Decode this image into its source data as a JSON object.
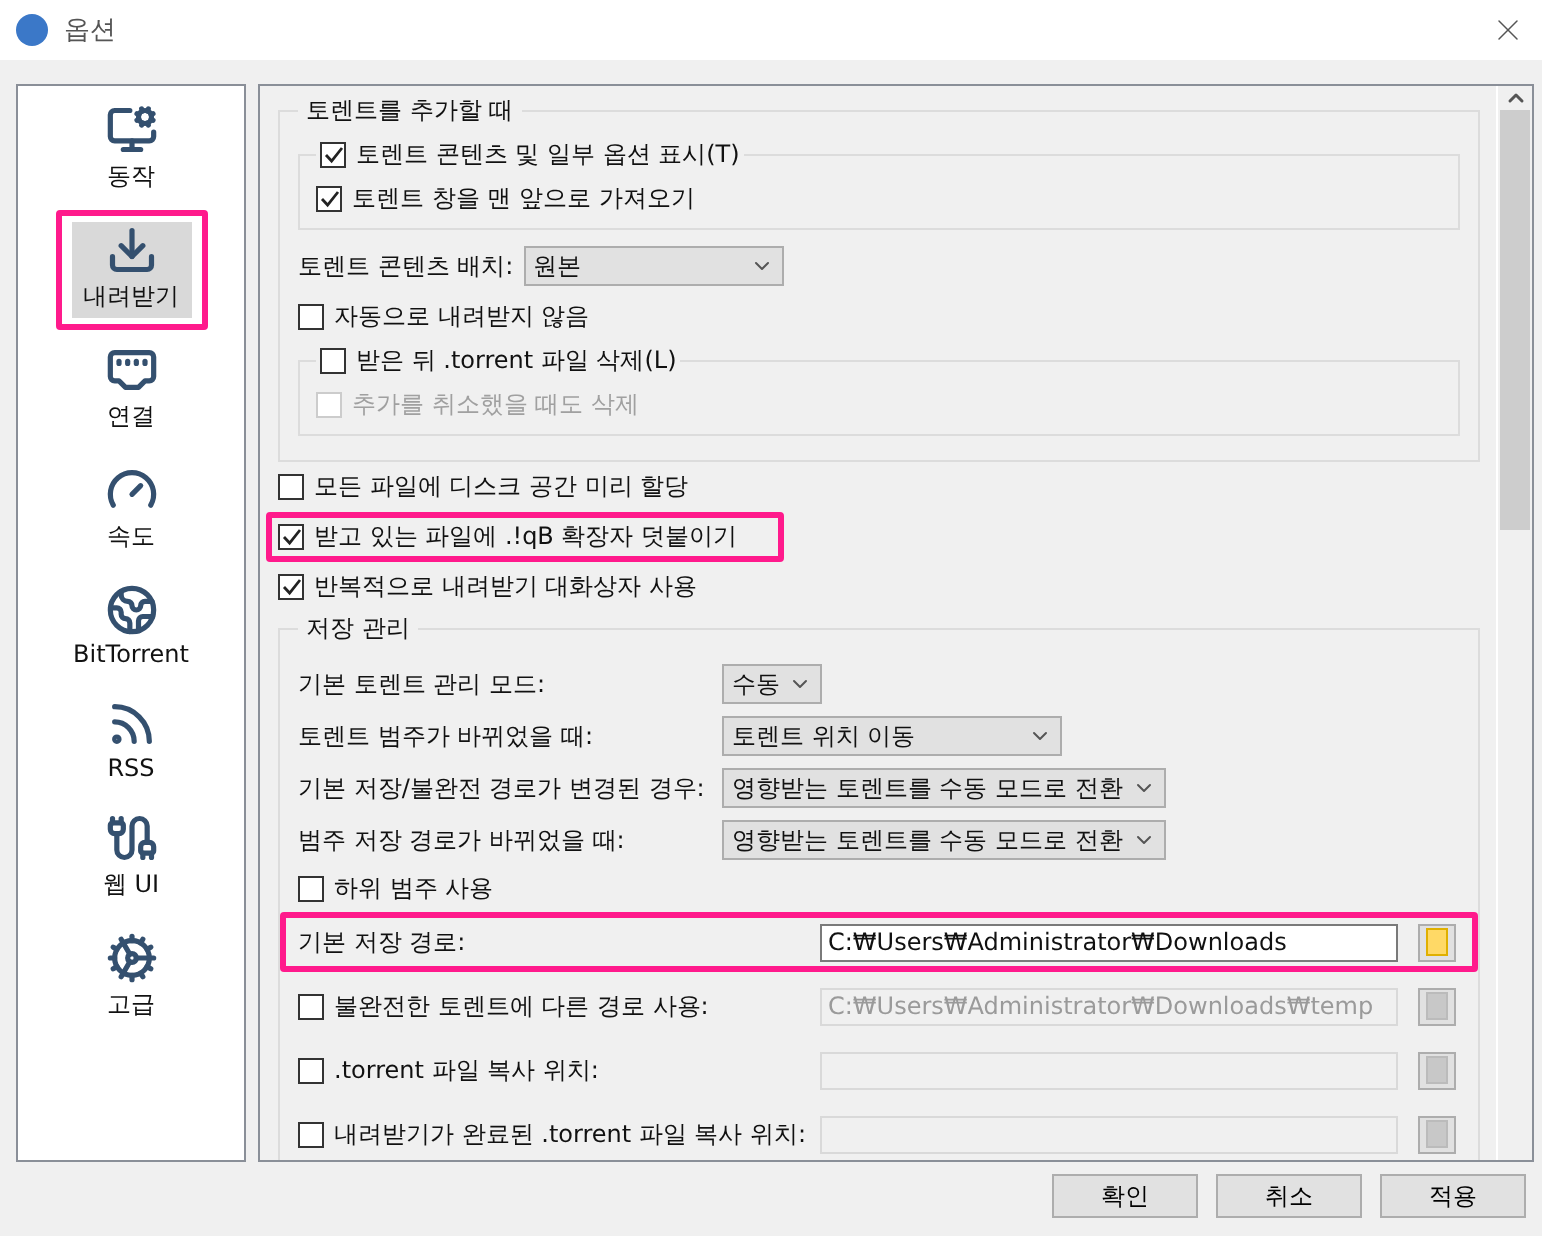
{
  "window": {
    "title": "옵션"
  },
  "sidebar": {
    "items": [
      {
        "label": "동작",
        "selected": false,
        "highlighted": false
      },
      {
        "label": "내려받기",
        "selected": true,
        "highlighted": true
      },
      {
        "label": "연결",
        "selected": false,
        "highlighted": false
      },
      {
        "label": "속도",
        "selected": false,
        "highlighted": false
      },
      {
        "label": "BitTorrent",
        "selected": false,
        "highlighted": false
      },
      {
        "label": "RSS",
        "selected": false,
        "highlighted": false
      },
      {
        "label": "웹 UI",
        "selected": false,
        "highlighted": false
      },
      {
        "label": "고급",
        "selected": false,
        "highlighted": false
      }
    ]
  },
  "adding_group": {
    "title": "토렌트를 추가할 때",
    "dialog_options": [
      {
        "label": "토렌트 콘텐츠 및 일부 옵션 표시(T)",
        "checked": true
      },
      {
        "label": "토렌트 창을 맨 앞으로 가져오기",
        "checked": true
      }
    ],
    "layout": {
      "label": "토렌트 콘텐츠 배치:",
      "value": "원본"
    },
    "no_auto_start": {
      "label": "자동으로 내려받지 않음",
      "checked": false
    },
    "delete_torrent": {
      "label": "받은 뒤 .torrent 파일 삭제(L)",
      "checked": false
    },
    "delete_on_cancel": {
      "label": "추가를 취소했을 때도 삭제",
      "checked": false,
      "disabled": true
    }
  },
  "options": [
    {
      "label": "모든 파일에 디스크 공간 미리 할당",
      "checked": false,
      "highlighted": false
    },
    {
      "label": "받고 있는 파일에 .!qB 확장자 덧붙이기",
      "checked": true,
      "highlighted": true
    },
    {
      "label": "반복적으로 내려받기 대화상자 사용",
      "checked": true,
      "highlighted": false
    }
  ],
  "storage_group": {
    "title": "저장 관리",
    "rows": [
      {
        "kind": "combo",
        "label": "기본 토렌트 관리 모드:",
        "value": "수동"
      },
      {
        "kind": "combo",
        "label": "토렌트 범주가 바뀌었을 때:",
        "value": "토렌트 위치 이동"
      },
      {
        "kind": "combo",
        "label": "기본 저장/불완전 경로가 변경된 경우:",
        "value": "영향받는 토렌트를 수동 모드로 전환"
      },
      {
        "kind": "combo",
        "label": "범주 저장 경로가 바뀌었을 때:",
        "value": "영향받는 토렌트를 수동 모드로 전환"
      },
      {
        "kind": "checkbox",
        "label": "하위 범주 사용",
        "checked": false
      },
      {
        "kind": "path",
        "label": "기본 저장 경로:",
        "value": "C:₩Users₩Administrator₩Downloads",
        "disabled": false,
        "highlighted": true
      },
      {
        "kind": "checkpath",
        "label": "불완전한 토렌트에 다른 경로 사용:",
        "checked": false,
        "value": "C:₩Users₩Administrator₩Downloads₩temp",
        "disabled": true,
        "highlighted": false
      },
      {
        "kind": "checkpath",
        "label": ".torrent 파일 복사 위치:",
        "checked": false,
        "disabled": true,
        "highlighted": false
      },
      {
        "kind": "checkpath",
        "label": "내려받기가 완료된 .torrent 파일 복사 위치:",
        "checked": false,
        "disabled": true,
        "highlighted": false
      }
    ]
  },
  "buttons": [
    "확인",
    "취소",
    "적용"
  ]
}
